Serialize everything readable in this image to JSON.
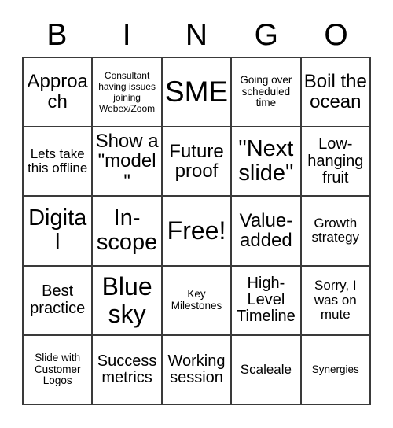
{
  "card": {
    "title": "BINGO",
    "headers": [
      "B",
      "I",
      "N",
      "G",
      "O"
    ],
    "text_color": "#000000",
    "border_color": "#3a3a3a",
    "background_color": "#ffffff",
    "rows": [
      [
        {
          "label": "Approach",
          "size": "m"
        },
        {
          "label": "Consultant having issues joining Webex/Zoom",
          "size": "tiny"
        },
        {
          "label": "SME",
          "size": "xxl"
        },
        {
          "label": "Going over scheduled time",
          "size": "xxs"
        },
        {
          "label": "Boil the ocean",
          "size": "m"
        }
      ],
      [
        {
          "label": "Lets take this offline",
          "size": "xs"
        },
        {
          "label": "Show a \"model\"",
          "size": "m"
        },
        {
          "label": "Future proof",
          "size": "m"
        },
        {
          "label": "\"Next slide\"",
          "size": "l"
        },
        {
          "label": "Low-hanging fruit",
          "size": "s"
        }
      ],
      [
        {
          "label": "Digital",
          "size": "l"
        },
        {
          "label": "In-scope",
          "size": "l"
        },
        {
          "label": "Free!",
          "size": "xl"
        },
        {
          "label": "Value-added",
          "size": "m"
        },
        {
          "label": "Growth strategy",
          "size": "xs"
        }
      ],
      [
        {
          "label": "Best practice",
          "size": "s"
        },
        {
          "label": "Blue sky",
          "size": "xl"
        },
        {
          "label": "Key Milestones",
          "size": "xxs"
        },
        {
          "label": "High-Level Timeline",
          "size": "s"
        },
        {
          "label": "Sorry, I was on mute",
          "size": "xs"
        }
      ],
      [
        {
          "label": "Slide with Customer Logos",
          "size": "xxs"
        },
        {
          "label": "Success metrics",
          "size": "s"
        },
        {
          "label": "Working session",
          "size": "s"
        },
        {
          "label": "Scaleale",
          "size": "xs"
        },
        {
          "label": "Synergies",
          "size": "xxs"
        }
      ]
    ]
  }
}
